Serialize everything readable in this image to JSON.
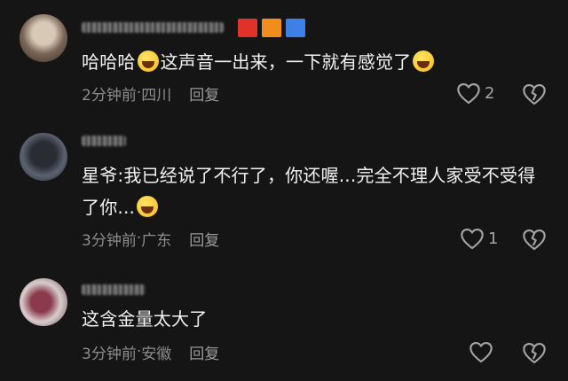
{
  "comments": [
    {
      "text_before": "哈哈哈",
      "text_after": "这声音一出来，一下就有感觉了",
      "time": "2分钟前",
      "location": "四川",
      "reply_label": "回复",
      "likes": "2",
      "avatar_colors": [
        "#c9b8a8",
        "#6b5a4a"
      ],
      "flag_colors": [
        "#e0322b",
        "#f08d1c",
        "#3f7fe8"
      ]
    },
    {
      "text": "星爷:我已经说了不行了，你还喔...完全不理人家受不受得了你...",
      "time": "3分钟前",
      "location": "广东",
      "reply_label": "回复",
      "likes": "1",
      "avatar_colors": [
        "#4a5260",
        "#1a1c22"
      ]
    },
    {
      "text": "这含金量太大了",
      "time": "3分钟前",
      "location": "安徽",
      "reply_label": "回复",
      "likes": "",
      "avatar_colors": [
        "#9a5a6a",
        "#e8e0e0"
      ]
    }
  ],
  "meta_separator": " · ",
  "colors": {
    "background": "#151515",
    "text": "#f2f2f2",
    "meta": "#8c8c8c"
  }
}
